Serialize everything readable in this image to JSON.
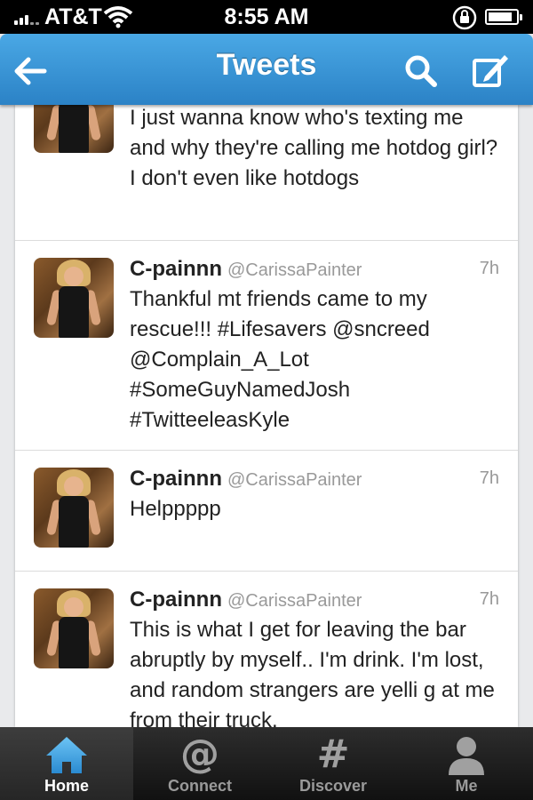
{
  "status_bar": {
    "carrier": "AT&T",
    "time": "8:55 AM",
    "battery_level": 0.85
  },
  "nav_bar": {
    "title": "Tweets",
    "icons": [
      "back-arrow-icon",
      "search-icon",
      "compose-icon"
    ]
  },
  "tweets": [
    {
      "name": "",
      "handle": "",
      "time": "",
      "text": "I just wanna know who's texting me and why they're calling me hotdog girl? I don't even like hotdogs"
    },
    {
      "name": "C-painnn",
      "handle": "@CarissaPainter",
      "time": "7h",
      "text": "Thankful mt friends came to my rescue!!! #Lifesavers @sncreed @Complain_A_Lot #SomeGuyNamedJosh #TwitteeleasKyle"
    },
    {
      "name": "C-painnn",
      "handle": "@CarissaPainter",
      "time": "7h",
      "text": "Helppppp"
    },
    {
      "name": "C-painnn",
      "handle": "@CarissaPainter",
      "time": "7h",
      "text": "This is what I get for leaving the bar abruptly by myself.. I'm drink. I'm lost, and random strangers are yelli g at me from their truck."
    }
  ],
  "tab_bar": {
    "tabs": [
      {
        "label": "Home",
        "icon": "home-icon",
        "active": true
      },
      {
        "label": "Connect",
        "icon": "at-sign-icon",
        "active": false
      },
      {
        "label": "Discover",
        "icon": "hashtag-icon",
        "active": false
      },
      {
        "label": "Me",
        "icon": "person-icon",
        "active": false
      }
    ]
  },
  "colors": {
    "nav_blue": "#2b82c6",
    "home_active_blue": "#4aa8e5"
  }
}
